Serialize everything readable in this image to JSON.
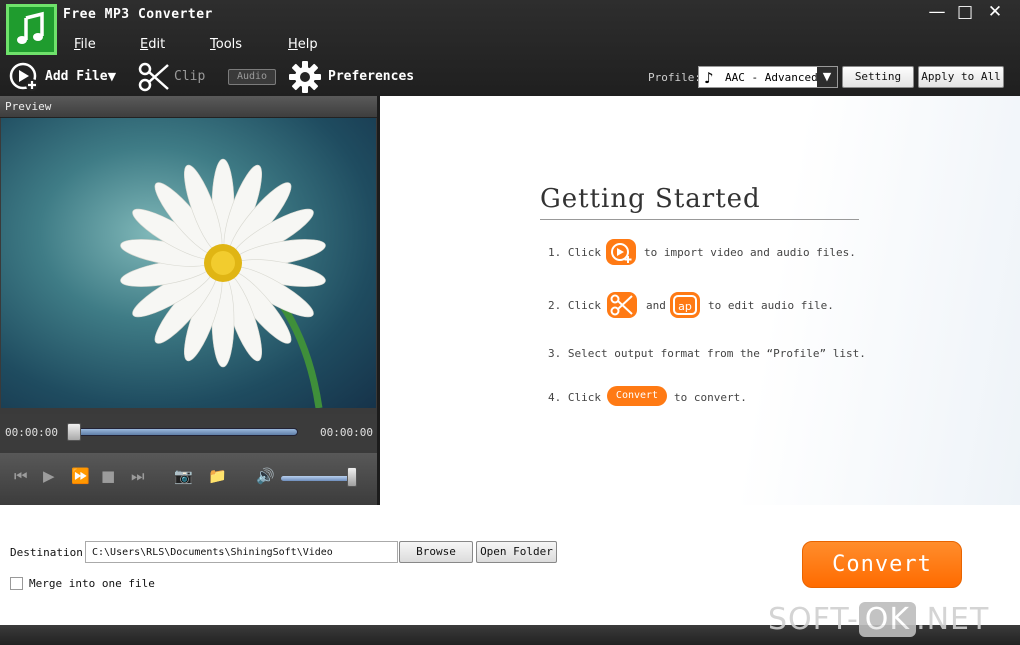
{
  "window": {
    "title": "Free MP3 Converter",
    "controls": [
      "—",
      "□",
      "✕"
    ]
  },
  "menu": [
    "File",
    "Edit",
    "Tools",
    "Help"
  ],
  "toolbar": {
    "add_file": "Add File",
    "clip": "Clip",
    "audio": "Audio",
    "preferences": "Preferences",
    "profile_label": "Profile:",
    "profile_value": "AAC - Advanced",
    "setting": "Setting",
    "apply_to_all": "Apply to All"
  },
  "preview": {
    "header": "Preview",
    "time_current": "00:00:00",
    "time_total": "00:00:00"
  },
  "getting_started": {
    "title": "Getting Started",
    "step1": {
      "prefix": "1. Click",
      "suffix": "to import video and audio files."
    },
    "step2": {
      "prefix": "2. Click",
      "middle": "and",
      "suffix": "to edit audio file."
    },
    "step3": "3. Select output format from the “Profile” list.",
    "step4": {
      "prefix": "4. Click",
      "button": "Convert",
      "suffix": "to convert."
    }
  },
  "bottom": {
    "destination_label": "Destination:",
    "destination_value": "C:\\Users\\RLS\\Documents\\ShiningSoft\\Video",
    "browse": "Browse",
    "open_folder": "Open Folder",
    "merge_label": "Merge into one file",
    "merge_checked": false,
    "convert": "Convert"
  },
  "watermark": {
    "left": "SOFT-",
    "ok": "OK",
    "right": ".NET"
  },
  "colors": {
    "accent": "#ff7a14",
    "toolbar_bg": "#262626",
    "logo_green": "#1f9c2e"
  }
}
